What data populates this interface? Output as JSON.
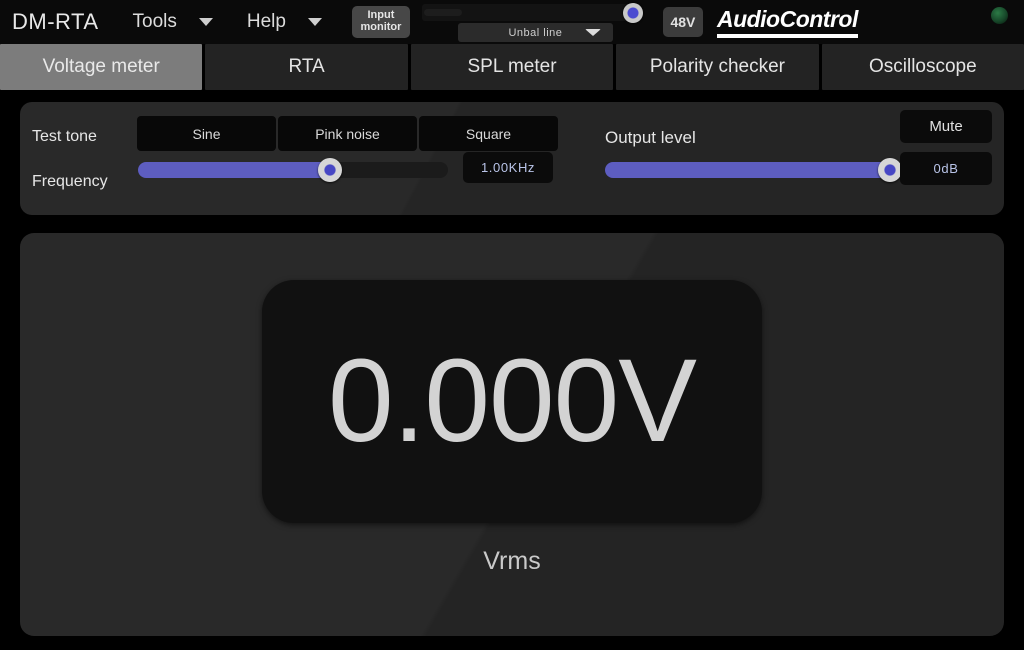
{
  "header": {
    "app_title": "DM-RTA",
    "menus": [
      {
        "label": "Tools",
        "icon": "chevron-down-icon"
      },
      {
        "label": "Help",
        "icon": "chevron-down-icon"
      }
    ],
    "input_monitor": {
      "line1": "Input",
      "line2": "monitor"
    },
    "input_slider": {
      "value": 100,
      "min": 0,
      "max": 100
    },
    "input_source": {
      "selected": "Unbal line",
      "icon": "chevron-down-icon"
    },
    "phantom_power": {
      "label": "48V",
      "active": false
    },
    "logo": {
      "text": "AudioControl"
    },
    "status_led": {
      "name": "power-led",
      "color": "#2c7a46",
      "lit": false
    }
  },
  "tabs": [
    {
      "label": "Voltage meter",
      "active": true
    },
    {
      "label": "RTA",
      "active": false
    },
    {
      "label": "SPL meter",
      "active": false
    },
    {
      "label": "Polarity checker",
      "active": false
    },
    {
      "label": "Oscilloscope",
      "active": false
    }
  ],
  "controls": {
    "test_tone": {
      "label": "Test tone",
      "options": [
        {
          "label": "Sine",
          "selected": false
        },
        {
          "label": "Pink noise",
          "selected": false
        },
        {
          "label": "Square",
          "selected": false
        }
      ]
    },
    "frequency": {
      "label": "Frequency",
      "value": "1.00KHz",
      "slider_percent": 62
    },
    "output_level": {
      "label": "Output level",
      "value": "0dB",
      "slider_percent": 100,
      "mute_label": "Mute"
    }
  },
  "display": {
    "value": "0.000V",
    "unit": "Vrms"
  },
  "colors": {
    "accent_slider": "#5d5dc0",
    "readout_text": "#b9c4e8",
    "active_tab_bg": "#7c7c7c",
    "panel_bg": "#252525",
    "page_bg": "#000000"
  }
}
